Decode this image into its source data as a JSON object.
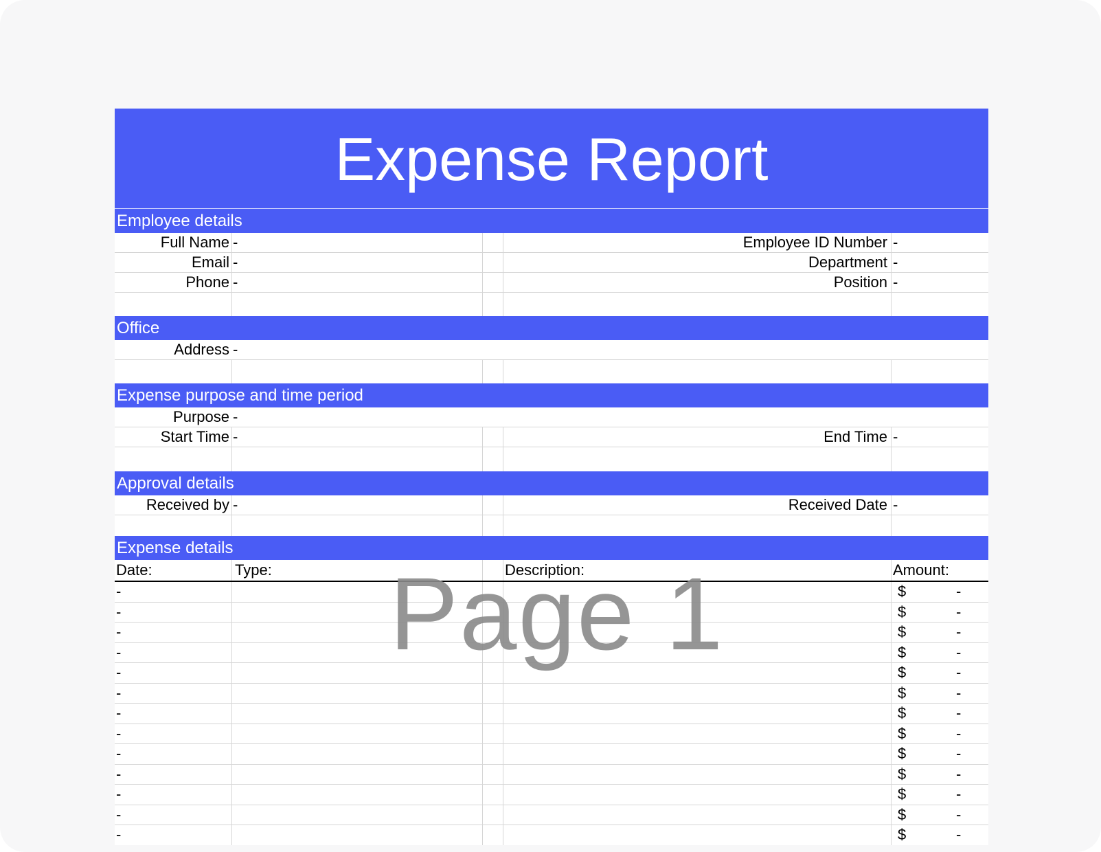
{
  "title": "Expense Report",
  "watermark": "Page 1",
  "colors": {
    "accent": "#4a5cf5",
    "title_text": "#ffffff",
    "watermark": "#8a8a8a"
  },
  "employee": {
    "section": "Employee details",
    "full_name_label": "Full Name",
    "full_name_value": "-",
    "email_label": "Email",
    "email_value": "-",
    "phone_label": "Phone",
    "phone_value": "-",
    "employee_id_label": "Employee ID Number",
    "employee_id_value": "-",
    "department_label": "Department",
    "department_value": "-",
    "position_label": "Position",
    "position_value": "-"
  },
  "office": {
    "section": "Office",
    "address_label": "Address",
    "address_value": "-"
  },
  "purpose": {
    "section": "Expense purpose and time period",
    "purpose_label": "Purpose",
    "purpose_value": "-",
    "start_label": "Start Time",
    "start_value": "-",
    "end_label": "End Time",
    "end_value": "-"
  },
  "approval": {
    "section": "Approval details",
    "received_by_label": "Received by",
    "received_by_value": "-",
    "received_date_label": "Received Date",
    "received_date_value": "-"
  },
  "expenses": {
    "section": "Expense details",
    "headers": {
      "date": "Date:",
      "type": "Type:",
      "description": "Description:",
      "amount": "Amount:"
    },
    "rows": [
      {
        "date": "-",
        "currency": "$",
        "amount": "-"
      },
      {
        "date": "-",
        "currency": "$",
        "amount": "-"
      },
      {
        "date": "-",
        "currency": "$",
        "amount": "-"
      },
      {
        "date": "-",
        "currency": "$",
        "amount": "-"
      },
      {
        "date": "-",
        "currency": "$",
        "amount": "-"
      },
      {
        "date": "-",
        "currency": "$",
        "amount": "-"
      },
      {
        "date": "-",
        "currency": "$",
        "amount": "-"
      },
      {
        "date": "-",
        "currency": "$",
        "amount": "-"
      },
      {
        "date": "-",
        "currency": "$",
        "amount": "-"
      },
      {
        "date": "-",
        "currency": "$",
        "amount": "-"
      },
      {
        "date": "-",
        "currency": "$",
        "amount": "-"
      },
      {
        "date": "-",
        "currency": "$",
        "amount": "-"
      },
      {
        "date": "-",
        "currency": "$",
        "amount": "-"
      }
    ]
  }
}
